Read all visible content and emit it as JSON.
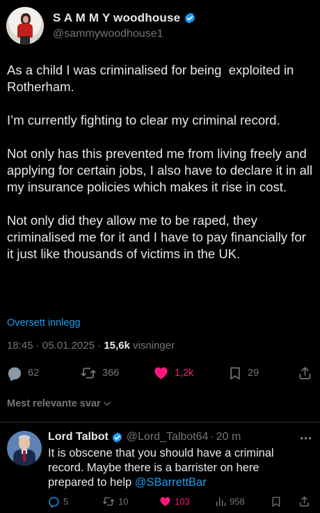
{
  "post": {
    "display_name": "S A M M Y woodhouse",
    "handle": "@sammywoodhouse1",
    "paragraphs": [
      "As a child I was criminalised for being  exploited in Rotherham.",
      "I’m currently fighting to clear my criminal record.",
      "Not only has this prevented me from living freely and applying for certain jobs, I also have to declare it in all my insurance policies which makes it rise in cost.",
      "Not only did they allow me to be raped, they criminalised me for it and I have to pay financially for it just like thousands of victims in the UK."
    ],
    "translate_label": "Oversett innlegg",
    "time": "18:45",
    "date": "05.01.2025",
    "separator": "·",
    "views_count": "15,6k",
    "views_label": "visninger",
    "actions": {
      "replies": "62",
      "reposts": "366",
      "likes": "1,2k",
      "bookmarks": "29"
    }
  },
  "sort_label": "Mest relevante svar",
  "reply": {
    "display_name": "Lord Talbot",
    "handle": "@Lord_Talbot64",
    "separator": "·",
    "time": "20 m",
    "text_before": "It is obscene that you should have a criminal record. Maybe there is a barrister on here prepared to help ",
    "mention": "@SBarrettBar",
    "actions": {
      "replies": "5",
      "reposts": "10",
      "likes": "103",
      "views": "958"
    }
  },
  "colors": {
    "background": "#000000",
    "text": "#e7e9ea",
    "secondary": "#71767b",
    "accent": "#1d9bf0",
    "like": "#f91880"
  },
  "icons": [
    "verified-badge-icon",
    "reply-icon",
    "repost-icon",
    "like-heart-filled-icon",
    "bookmark-icon",
    "share-icon",
    "chevron-down-icon",
    "views-icon",
    "more-icon"
  ]
}
